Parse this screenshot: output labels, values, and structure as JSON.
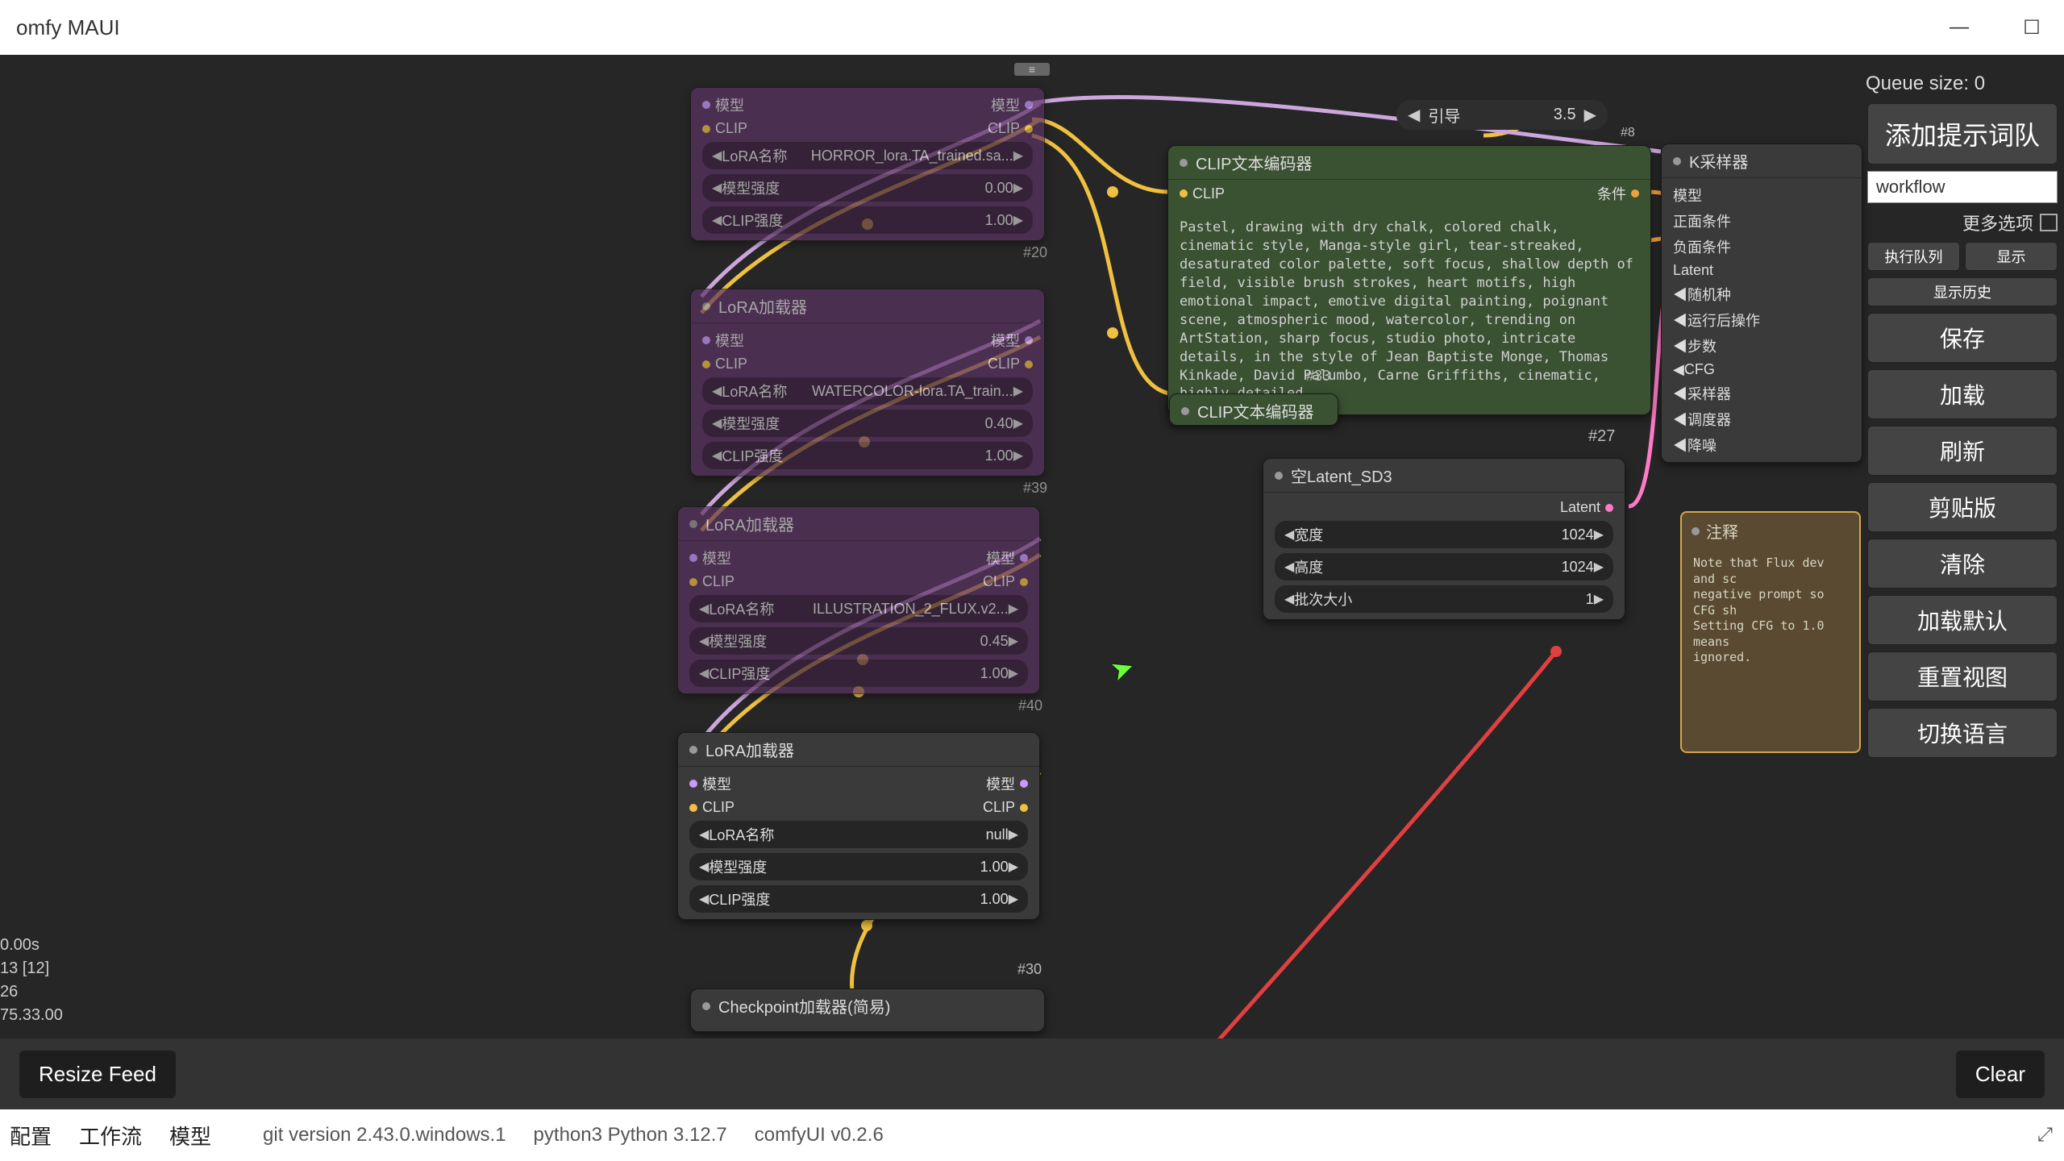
{
  "window": {
    "title": "omfy MAUI"
  },
  "sidebar": {
    "queue_label": "Queue size: 0",
    "main_button": "添加提示词队",
    "workflow_input": "workflow",
    "more_options": "更多选项",
    "small_row1": [
      "执行队列",
      "显示"
    ],
    "small_row2_btn": "显示历史",
    "buttons": [
      "保存",
      "加载",
      "刷新",
      "剪贴版",
      "清除",
      "加载默认",
      "重置视图",
      "切换语言"
    ]
  },
  "guidance": {
    "label": "引导",
    "value": "3.5",
    "id_label": "#8"
  },
  "ksampler": {
    "title": "K采样器",
    "rows": [
      "模型",
      "正面条件",
      "负面条件",
      "Latent",
      "随机种",
      "运行后操作",
      "步数",
      "CFG",
      "采样器",
      "调度器",
      "降噪"
    ]
  },
  "clip_encoder": {
    "title": "CLIP文本编码器",
    "clip_label": "CLIP",
    "cond_label": "条件",
    "prompt": "Pastel, drawing with dry chalk, colored chalk, cinematic style, Manga-style girl, tear-streaked, desaturated color palette, soft focus, shallow depth of field, visible brush strokes, heart motifs, high emotional impact, emotive digital painting, poignant scene, atmospheric mood, watercolor, trending on ArtStation, sharp focus, studio photo, intricate details, in the style of Jean Baptiste Monge, Thomas Kinkade, David Palumbo, Carne Griffiths, cinematic, highly detailed.",
    "id": "#33"
  },
  "clip_encoder2": {
    "title": "CLIP文本编码器",
    "id_label": "#27"
  },
  "latent": {
    "title": "空Latent_SD3",
    "out_label": "Latent",
    "rows": [
      {
        "label": "宽度",
        "value": "1024"
      },
      {
        "label": "高度",
        "value": "1024"
      },
      {
        "label": "批次大小",
        "value": "1"
      }
    ]
  },
  "note": {
    "title": "注释",
    "text": "Note that Flux dev and sc\nnegative prompt so CFG sh\nSetting CFG to 1.0 means\nignored."
  },
  "lora_nodes": [
    {
      "title": "",
      "slots": [
        {
          "left": "模型",
          "right": "模型"
        },
        {
          "left": "CLIP",
          "right": "CLIP"
        }
      ],
      "params": [
        {
          "label": "LoRA名称",
          "value": "HORROR_lora.TA_trained.sa..."
        },
        {
          "label": "模型强度",
          "value": "0.00"
        },
        {
          "label": "CLIP强度",
          "value": "1.00"
        }
      ],
      "id": "#20"
    },
    {
      "title": "LoRA加载器",
      "slots": [
        {
          "left": "模型",
          "right": "模型"
        },
        {
          "left": "CLIP",
          "right": "CLIP"
        }
      ],
      "params": [
        {
          "label": "LoRA名称",
          "value": "WATERCOLOR-lora.TA_train..."
        },
        {
          "label": "模型强度",
          "value": "0.40"
        },
        {
          "label": "CLIP强度",
          "value": "1.00"
        }
      ],
      "id": "#39"
    },
    {
      "title": "LoRA加载器",
      "slots": [
        {
          "left": "模型",
          "right": "模型"
        },
        {
          "left": "CLIP",
          "right": "CLIP"
        }
      ],
      "params": [
        {
          "label": "LoRA名称",
          "value": "ILLUSTRATION_2_FLUX.v2..."
        },
        {
          "label": "模型强度",
          "value": "0.45"
        },
        {
          "label": "CLIP强度",
          "value": "1.00"
        }
      ],
      "id": "#40"
    }
  ],
  "lora_active": {
    "title": "LoRA加载器",
    "slots": [
      {
        "left": "模型",
        "right": "模型"
      },
      {
        "left": "CLIP",
        "right": "CLIP"
      }
    ],
    "params": [
      {
        "label": "LoRA名称",
        "value": "null"
      },
      {
        "label": "模型强度",
        "value": "1.00"
      },
      {
        "label": "CLIP强度",
        "value": "1.00"
      }
    ],
    "id": "#30"
  },
  "checkpoint": {
    "title": "Checkpoint加载器(简易)"
  },
  "status": {
    "lines": [
      "0.00s",
      "",
      "13 [12]",
      "26",
      "75.33.00"
    ]
  },
  "lower": {
    "resize": "Resize Feed",
    "clear": "Clear"
  },
  "footer": {
    "tabs": [
      "配置",
      "工作流",
      "模型"
    ],
    "info": [
      "git version 2.43.0.windows.1",
      "python3 Python 3.12.7",
      "comfyUI v0.2.6"
    ]
  }
}
